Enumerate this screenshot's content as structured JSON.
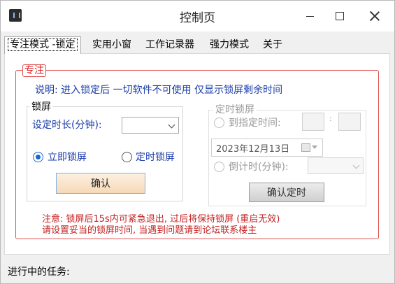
{
  "window": {
    "title": "控制页"
  },
  "tabs": [
    {
      "label": "专注模式 -锁定",
      "active": true
    },
    {
      "label": "实用小窗",
      "active": false
    },
    {
      "label": "工作记录器",
      "active": false
    },
    {
      "label": "强力模式",
      "active": false
    },
    {
      "label": "关于",
      "active": false
    }
  ],
  "focus": {
    "group_title": "专注",
    "description": "说明: 进入锁定后 一切软件不可使用 仅显示锁屏剩余时间",
    "lock": {
      "group_title": "锁屏",
      "duration_label": "设定时长(分钟):",
      "duration_value": "",
      "radio_immediate": "立即锁屏",
      "radio_immediate_checked": true,
      "radio_timed": "定时锁屏",
      "radio_timed_checked": false,
      "confirm_label": "确认"
    },
    "timer": {
      "group_title": "定时锁屏",
      "to_time_label": "到指定时间:",
      "colon": ":",
      "date_value": "2023年12月13日",
      "countdown_label": "倒计时(分钟):",
      "confirm_label": "确认定时"
    },
    "note_line1": "注意: 锁屏后15s内可紧急退出, 过后将保持锁屏 (重启无效)",
    "note_line2": "请设置妥当的锁屏时间, 当遇到问题请到论坛联系楼主"
  },
  "status": {
    "label": "进行中的任务:"
  },
  "colors": {
    "accent_blue": "#1a3ca8",
    "warning_red": "#c41f1f",
    "group_border_red": "#e05050"
  }
}
